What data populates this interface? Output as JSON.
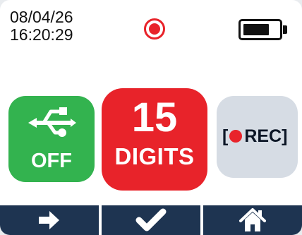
{
  "status": {
    "date": "08/04/26",
    "time": "16:20:29",
    "recording_indicator": "record-indicator-icon",
    "battery_level": 0.75
  },
  "tiles": {
    "usb": {
      "label": "OFF",
      "icon": "usb-icon",
      "color": "#33b34f"
    },
    "digits": {
      "value": "15",
      "label": "DIGITS",
      "color": "#e8232a"
    },
    "rec": {
      "open_bracket": "[",
      "label": "REC]",
      "icon": "record-dot-icon",
      "color": "#d6dce4"
    }
  },
  "navbar": {
    "color": "#1e3451",
    "buttons": [
      {
        "icon": "arrow-right-icon"
      },
      {
        "icon": "checkmark-icon"
      },
      {
        "icon": "home-icon"
      }
    ]
  }
}
